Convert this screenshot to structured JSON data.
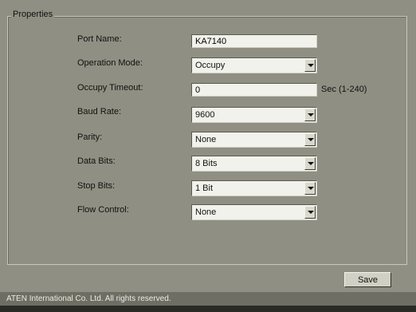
{
  "properties": {
    "group_title": "Properties",
    "fields": {
      "port_name": {
        "label": "Port Name:",
        "value": "KA7140"
      },
      "operation_mode": {
        "label": "Operation Mode:",
        "value": "Occupy"
      },
      "occupy_timeout": {
        "label": "Occupy Timeout:",
        "value": "0",
        "unit": "Sec (1-240)"
      },
      "baud_rate": {
        "label": "Baud Rate:",
        "value": "9600"
      },
      "parity": {
        "label": "Parity:",
        "value": "None"
      },
      "data_bits": {
        "label": "Data Bits:",
        "value": "8 Bits"
      },
      "stop_bits": {
        "label": "Stop Bits:",
        "value": "1 Bit"
      },
      "flow_control": {
        "label": "Flow Control:",
        "value": "None"
      }
    }
  },
  "actions": {
    "save_label": "Save"
  },
  "footer": {
    "copyright": "ATEN International Co. Ltd. All rights reserved."
  }
}
